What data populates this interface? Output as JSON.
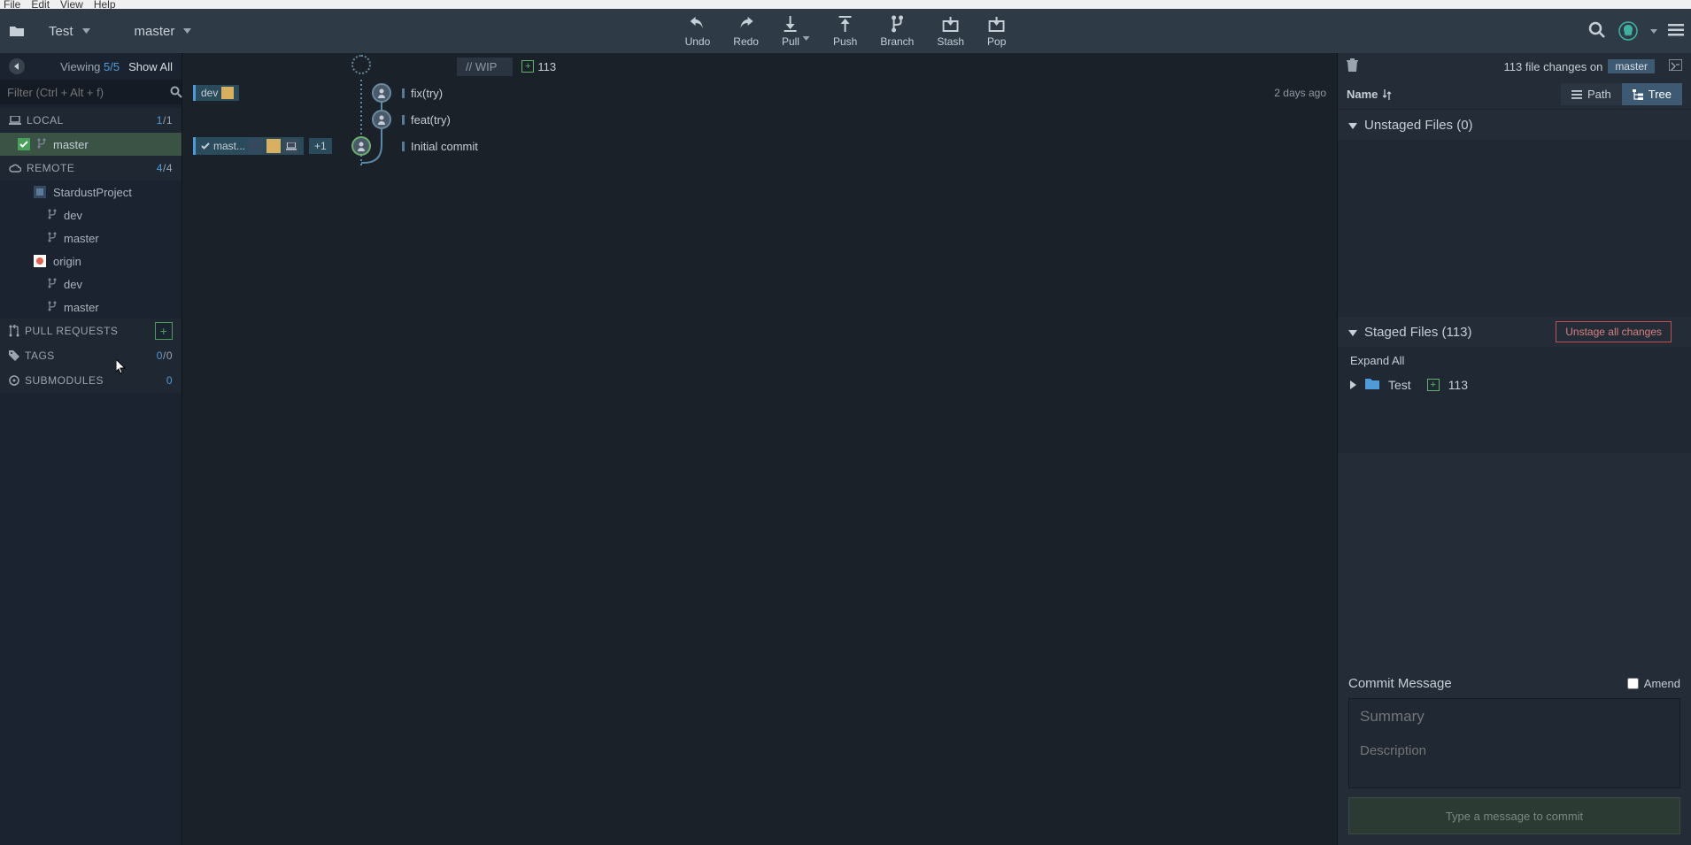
{
  "menubar": [
    "File",
    "Edit",
    "View",
    "Help"
  ],
  "breadcrumb": {
    "repo": "Test",
    "branch": "master"
  },
  "toolbar": {
    "undo": "Undo",
    "redo": "Redo",
    "pull": "Pull",
    "push": "Push",
    "branch": "Branch",
    "stash": "Stash",
    "pop": "Pop"
  },
  "left": {
    "viewing_label": "Viewing",
    "viewing_count": "5/5",
    "show_all": "Show All",
    "filter_placeholder": "Filter (Ctrl + Alt + f)",
    "sections": {
      "local": {
        "label": "LOCAL",
        "count_a": "1",
        "count_b": "/1"
      },
      "remote": {
        "label": "REMOTE",
        "count_a": "4",
        "count_b": "/4"
      },
      "prs": {
        "label": "PULL REQUESTS"
      },
      "tags": {
        "label": "TAGS",
        "count_a": "0",
        "count_b": "/0"
      },
      "submodules": {
        "label": "SUBMODULES",
        "count": "0"
      }
    },
    "local_branches": [
      {
        "name": "master"
      }
    ],
    "remotes": [
      {
        "name": "StardustProject",
        "branches": [
          "dev",
          "master"
        ]
      },
      {
        "name": "origin",
        "branches": [
          "dev",
          "master"
        ]
      }
    ]
  },
  "graph": {
    "wip_label": "//  WIP",
    "wip_count": "113",
    "rows": [
      {
        "tag": "dev",
        "msg": "fix(try)",
        "date": "2 days ago"
      },
      {
        "msg": "feat(try)"
      },
      {
        "tag": "mast...",
        "plus": "+1",
        "msg": "Initial commit"
      }
    ]
  },
  "right": {
    "top_text": "113 file changes on",
    "top_branch": "master",
    "name_label": "Name",
    "path_label": "Path",
    "tree_label": "Tree",
    "unstaged_title": "Unstaged Files (0)",
    "staged_title": "Staged Files (113)",
    "unstage_all": "Unstage all changes",
    "expand_all": "Expand All",
    "tree_root": "Test",
    "tree_root_count": "113",
    "commit_msg_label": "Commit Message",
    "amend_label": "Amend",
    "summary_placeholder": "Summary",
    "desc_placeholder": "Description",
    "commit_btn": "Type a message to commit"
  }
}
